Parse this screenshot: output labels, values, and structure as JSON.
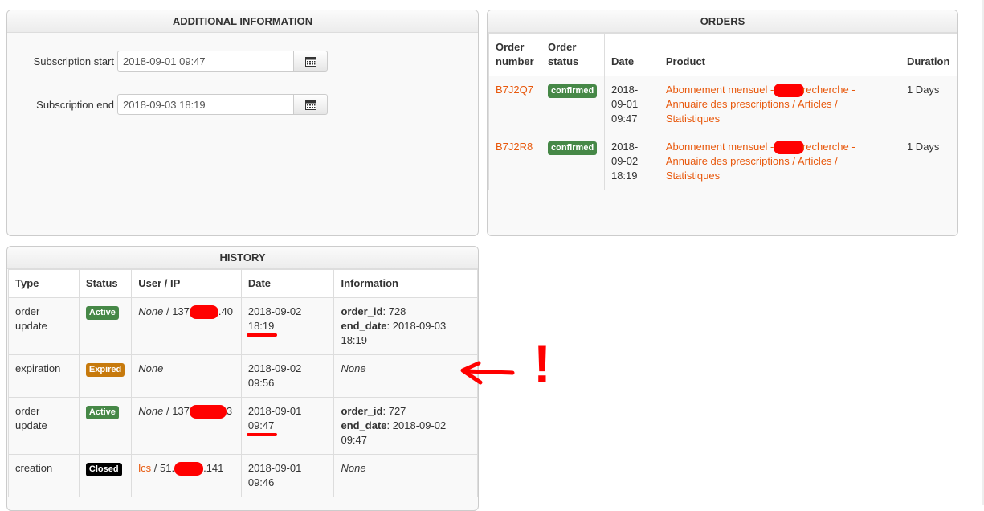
{
  "additional": {
    "title": "ADDITIONAL INFORMATION",
    "start_label": "Subscription start",
    "start_value": "2018-09-01 09:47",
    "end_label": "Subscription end",
    "end_value": "2018-09-03 18:19"
  },
  "orders": {
    "title": "ORDERS",
    "headers": [
      "Order number",
      "Order status",
      "Date",
      "Product",
      "Duration"
    ],
    "rows": [
      {
        "number": "B7J2Q7",
        "status": "confirmed",
        "date": "2018-09-01 09:47",
        "product_a": "Abonnement mensuel - ",
        "product_b": "recherche - Annuaire des prescriptions / Articles / Statistiques",
        "duration": "1 Days"
      },
      {
        "number": "B7J2R8",
        "status": "confirmed",
        "date": "2018-09-02 18:19",
        "product_a": "Abonnement mensuel - ",
        "product_b": "recherche - Annuaire des prescriptions / Articles / Statistiques",
        "duration": "1 Days"
      }
    ]
  },
  "history": {
    "title": "HISTORY",
    "headers": [
      "Type",
      "Status",
      "User / IP",
      "Date",
      "Information"
    ],
    "rows": [
      {
        "type": "order update",
        "status": "Active",
        "user": "None",
        "ip_a": "137",
        "ip_b": ".40",
        "date_d": "2018-09-02",
        "date_t": "18:19",
        "info_k1": "order_id",
        "info_v1": ": 728",
        "info_k2": "end_date",
        "info_v2": ": 2018-09-03 18:19"
      },
      {
        "type": "expiration",
        "status": "Expired",
        "user": "None",
        "date_d": "2018-09-02",
        "date_t": "09:56",
        "info": "None"
      },
      {
        "type": "order update",
        "status": "Active",
        "user": "None",
        "ip_a": "137",
        "ip_b": "3",
        "date_d": "2018-09-01",
        "date_t": "09:47",
        "info_k1": "order_id",
        "info_v1": ": 727",
        "info_k2": "end_date",
        "info_v2": ": 2018-09-02 09:47"
      },
      {
        "type": "creation",
        "status": "Closed",
        "user": "lcs",
        "ip_a": "51.",
        "ip_b": ".141",
        "date_d": "2018-09-01",
        "date_t": "09:46",
        "info": "None"
      }
    ]
  },
  "annotation": {
    "mark": "!"
  },
  "colors": {
    "accent": "#e8580c",
    "active": "#468847",
    "expired": "#c77a0d",
    "closed": "#000000",
    "annotation": "#ff0000"
  }
}
